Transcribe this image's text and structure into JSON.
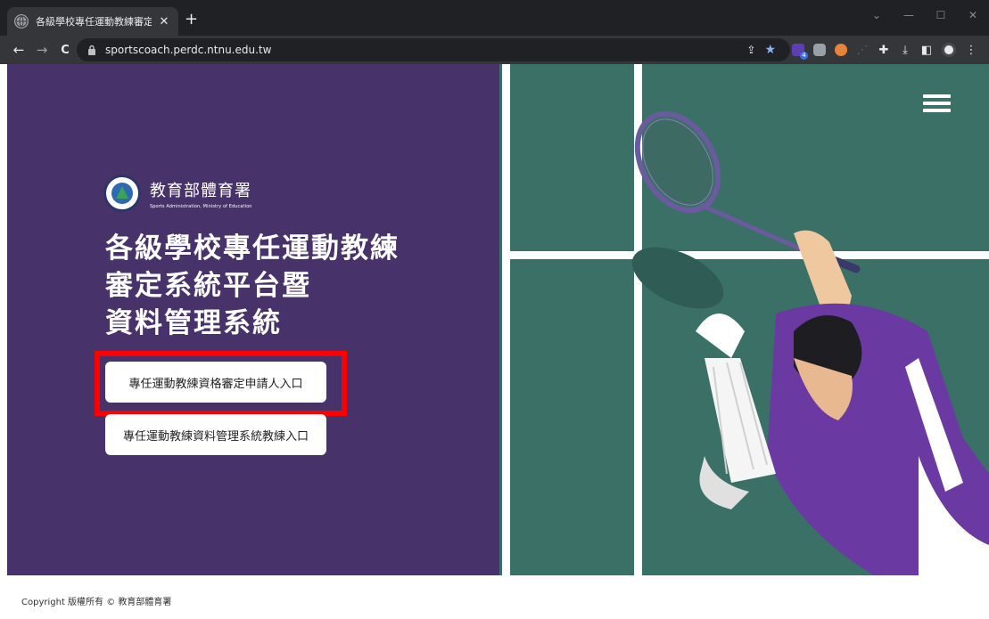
{
  "browser": {
    "tab_title": "各級學校專任運動教練審定系統",
    "tab_close": "✕",
    "new_tab": "+",
    "back": "←",
    "forward": "→",
    "reload": "C",
    "url": "sportscoach.perdc.ntnu.edu.tw",
    "share": "⇪",
    "bookmark": "★",
    "extension_badge": "4",
    "colors": {
      "tabbar": "#202124",
      "toolbar": "#35363a",
      "bookmark_star": "#8ab4f8"
    }
  },
  "header": {
    "logo_cn": "教育部體育署",
    "logo_en": "Sports Administration, Ministry of Education"
  },
  "hero": {
    "title_lines": [
      "各級學校專任運動教練",
      "審定系統平台暨",
      "資料管理系統"
    ],
    "applicant_entry_label": "專任運動教練資格審定申請人入口",
    "coach_entry_label": "專任運動教練資料管理系統教練入口"
  },
  "footer": {
    "copyright": "Copyright 版權所有 © 教育部體育署"
  },
  "colors": {
    "left_panel": "#47336a",
    "court": "#3a7066",
    "player_shirt": "#6a3aa2",
    "highlight": "#ff0000"
  },
  "icons": [
    "globe-icon",
    "lock-icon",
    "share-icon",
    "star-icon",
    "puzzle-icon",
    "download-icon",
    "sidebar-icon",
    "profile-icon",
    "menu-icon",
    "hamburger-icon"
  ]
}
